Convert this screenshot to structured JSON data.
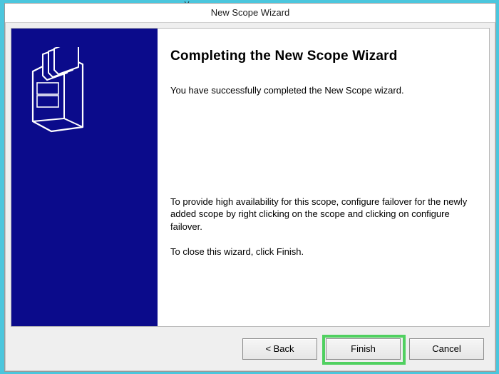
{
  "window": {
    "title": "New Scope Wizard"
  },
  "content": {
    "heading": "Completing the New Scope Wizard",
    "success_line": "You have successfully completed the New Scope wizard.",
    "failover_note": "To provide high availability for this scope, configure failover for the newly added scope by right clicking on the scope and clicking on configure failover.",
    "close_line": "To close this wizard, click Finish."
  },
  "buttons": {
    "back": "< Back",
    "finish": "Finish",
    "cancel": "Cancel"
  }
}
